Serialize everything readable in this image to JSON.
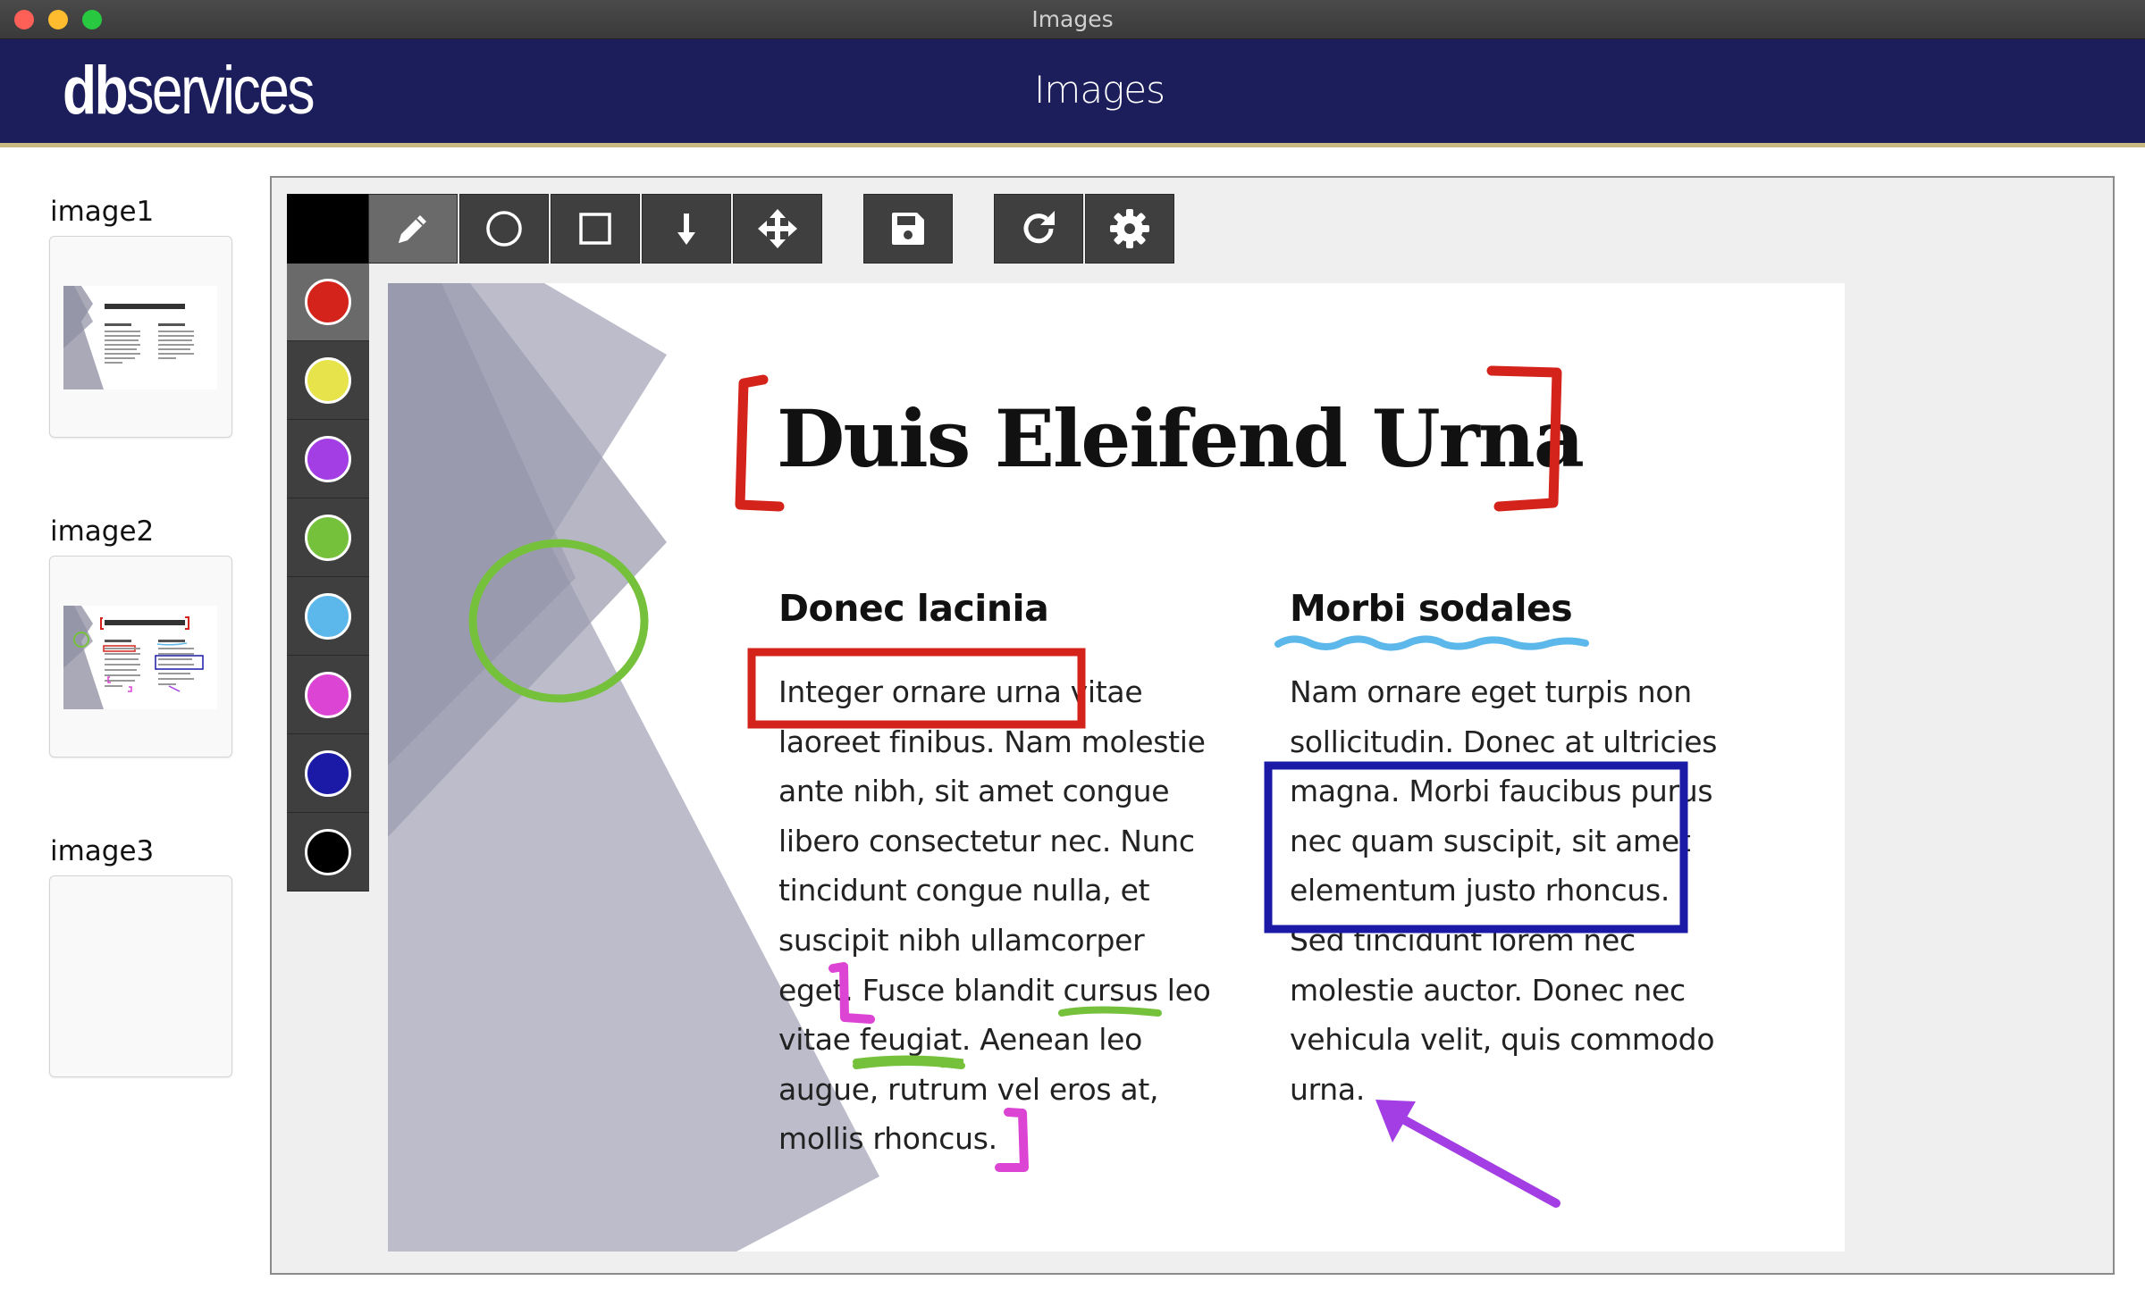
{
  "window": {
    "title": "Images"
  },
  "app": {
    "logo_bold": "db",
    "logo_rest": "services",
    "title": "Images"
  },
  "sidebar": {
    "items": [
      {
        "label": "image1"
      },
      {
        "label": "image2"
      },
      {
        "label": "image3"
      }
    ]
  },
  "toolbar": {
    "current_color": "#000000",
    "tools": [
      {
        "icon": "pencil-icon",
        "active": true
      },
      {
        "icon": "circle-icon"
      },
      {
        "icon": "square-icon"
      },
      {
        "icon": "arrow-down-icon"
      },
      {
        "icon": "move-icon"
      }
    ],
    "actions": [
      {
        "icon": "save-icon"
      },
      {
        "icon": "redo-icon"
      },
      {
        "icon": "gear-icon"
      }
    ]
  },
  "palette": [
    {
      "color": "#d3231b",
      "name": "red",
      "active": true
    },
    {
      "color": "#e6e44a",
      "name": "yellow"
    },
    {
      "color": "#a23ee3",
      "name": "purple"
    },
    {
      "color": "#76c13c",
      "name": "green"
    },
    {
      "color": "#5cb8ea",
      "name": "light-blue"
    },
    {
      "color": "#dc44d4",
      "name": "magenta"
    },
    {
      "color": "#1a1aa6",
      "name": "dark-blue"
    },
    {
      "color": "#000000",
      "name": "black"
    }
  ],
  "document": {
    "title": "Duis Eleifend Urna",
    "left_heading": "Donec lacinia",
    "left_text": "Integer ornare urna vitae\nlaoreet finibus. Nam molestie\nante nibh, sit amet congue\nlibero consectetur nec. Nunc\ntincidunt congue nulla, et\nsuscipit nibh ullamcorper\neget. Fusce blandit cursus leo\nvitae feugiat. Aenean leo\naugue, rutrum vel eros at,\nmollis rhoncus.",
    "right_heading": "Morbi sodales",
    "right_text": "Nam ornare eget turpis non\nsollicitudin. Donec at ultricies\nmagna. Morbi faucibus purus\nnec quam suscipit, sit amet\nelementum justo rhoncus.\nSed tincidunt lorem nec\nmolestie auctor. Donec nec\nvehicula velit, quis commodo\nurna."
  }
}
